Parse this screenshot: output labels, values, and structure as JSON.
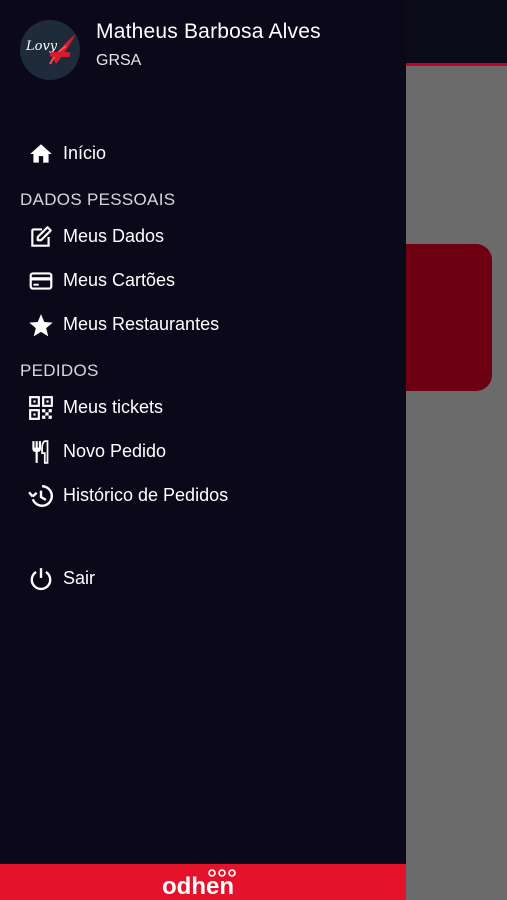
{
  "user": {
    "name": "Matheus Barbosa Alves",
    "company": "GRSA"
  },
  "avatar": {
    "logo_text": "Lovy"
  },
  "menu": {
    "inicio": {
      "label": "Início",
      "icon": "home-icon"
    },
    "section_dados": "DADOS PESSOAIS",
    "meus_dados": {
      "label": "Meus Dados",
      "icon": "edit-icon"
    },
    "meus_cartoes": {
      "label": "Meus Cartões",
      "icon": "credit-card-icon"
    },
    "meus_restaurantes": {
      "label": "Meus Restaurantes",
      "icon": "star-icon"
    },
    "section_pedidos": "PEDIDOS",
    "meus_tickets": {
      "label": "Meus tickets",
      "icon": "qr-code-icon"
    },
    "novo_pedido": {
      "label": "Novo Pedido",
      "icon": "fork-knife-icon"
    },
    "historico": {
      "label": "Histórico de Pedidos",
      "icon": "history-icon"
    },
    "sair": {
      "label": "Sair",
      "icon": "power-icon"
    }
  },
  "footer": {
    "brand": "odhen"
  },
  "colors": {
    "drawer_bg": "#0b0919",
    "accent": "#e4132b",
    "overlay": "#6b6b6b"
  }
}
